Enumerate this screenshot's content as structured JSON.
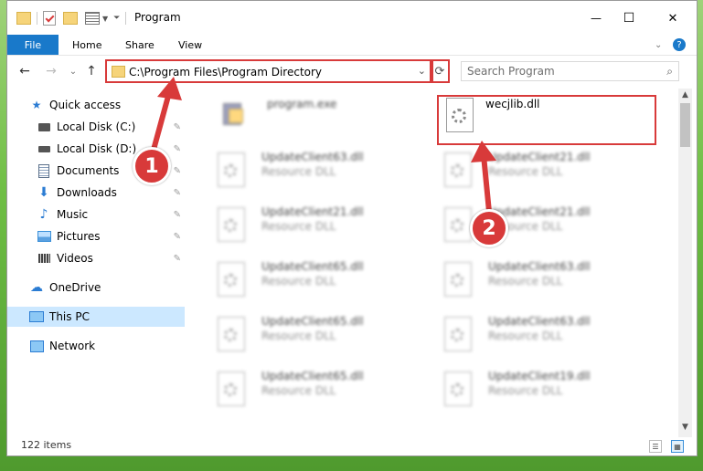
{
  "window": {
    "title": "Program",
    "controls": {
      "minimize": "—",
      "maximize": "☐",
      "close": "✕"
    }
  },
  "ribbon": {
    "file": "File",
    "tabs": [
      "Home",
      "Share",
      "View"
    ],
    "help": "?"
  },
  "nav": {
    "back": "←",
    "forward": "→",
    "recent": "⌄",
    "up": "↑",
    "address": "C:\\Program Files\\Program Directory",
    "refresh": "⟳",
    "search_placeholder": "Search Program",
    "search_icon": "⌕"
  },
  "sidebar": {
    "items": [
      {
        "label": "Quick access",
        "icon": "star-icon",
        "glyph": "★",
        "color": "#2b7cd3"
      },
      {
        "label": "Local Disk (C:)",
        "icon": "drive-icon",
        "glyph": "▭",
        "color": "#555555",
        "pinned": true
      },
      {
        "label": "Local Disk (D:)",
        "icon": "drive-icon",
        "glyph": "▭",
        "color": "#555555",
        "pinned": true
      },
      {
        "label": "Documents",
        "icon": "document-icon",
        "glyph": "▤",
        "color": "#5a6f8a",
        "pinned": true
      },
      {
        "label": "Downloads",
        "icon": "download-icon",
        "glyph": "⬇",
        "color": "#2b7cd3",
        "pinned": true
      },
      {
        "label": "Music",
        "icon": "music-icon",
        "glyph": "♪",
        "color": "#2b7cd3",
        "pinned": true
      },
      {
        "label": "Pictures",
        "icon": "pictures-icon",
        "glyph": "▦",
        "color": "#3a8fd8",
        "pinned": true
      },
      {
        "label": "Videos",
        "icon": "videos-icon",
        "glyph": "▶",
        "color": "#555555",
        "pinned": true
      },
      {
        "label": "OneDrive",
        "icon": "cloud-icon",
        "glyph": "☁",
        "color": "#2b7cd3"
      },
      {
        "label": "This PC",
        "icon": "computer-icon",
        "glyph": "▭",
        "color": "#2b7cd3",
        "selected": true
      },
      {
        "label": "Network",
        "icon": "network-icon",
        "glyph": "⊞",
        "color": "#2b7cd3"
      }
    ],
    "pin_glyph": "📌"
  },
  "files": {
    "program_exe": {
      "name": "program.exe"
    },
    "target": {
      "name": "wecjlib.dll"
    },
    "left_column": [
      {
        "name": "UpdateClient63.dll",
        "type": "Resource DLL"
      },
      {
        "name": "UpdateClient21.dll",
        "type": "Resource DLL"
      },
      {
        "name": "UpdateClient65.dll",
        "type": "Resource DLL"
      },
      {
        "name": "UpdateClient65.dll",
        "type": "Resource DLL"
      },
      {
        "name": "UpdateClient65.dll",
        "type": "Resource DLL"
      }
    ],
    "right_column": [
      {
        "name": "UpdateClient21.dll",
        "type": "Resource DLL"
      },
      {
        "name": "UpdateClient21.dll",
        "type": "Resource DLL"
      },
      {
        "name": "UpdateClient63.dll",
        "type": "Resource DLL"
      },
      {
        "name": "UpdateClient63.dll",
        "type": "Resource DLL"
      },
      {
        "name": "UpdateClient19.dll",
        "type": "Resource DLL"
      }
    ]
  },
  "status": {
    "count": "122 items"
  },
  "annotations": {
    "step1": "1",
    "step2": "2",
    "accent": "#d83a3a"
  }
}
